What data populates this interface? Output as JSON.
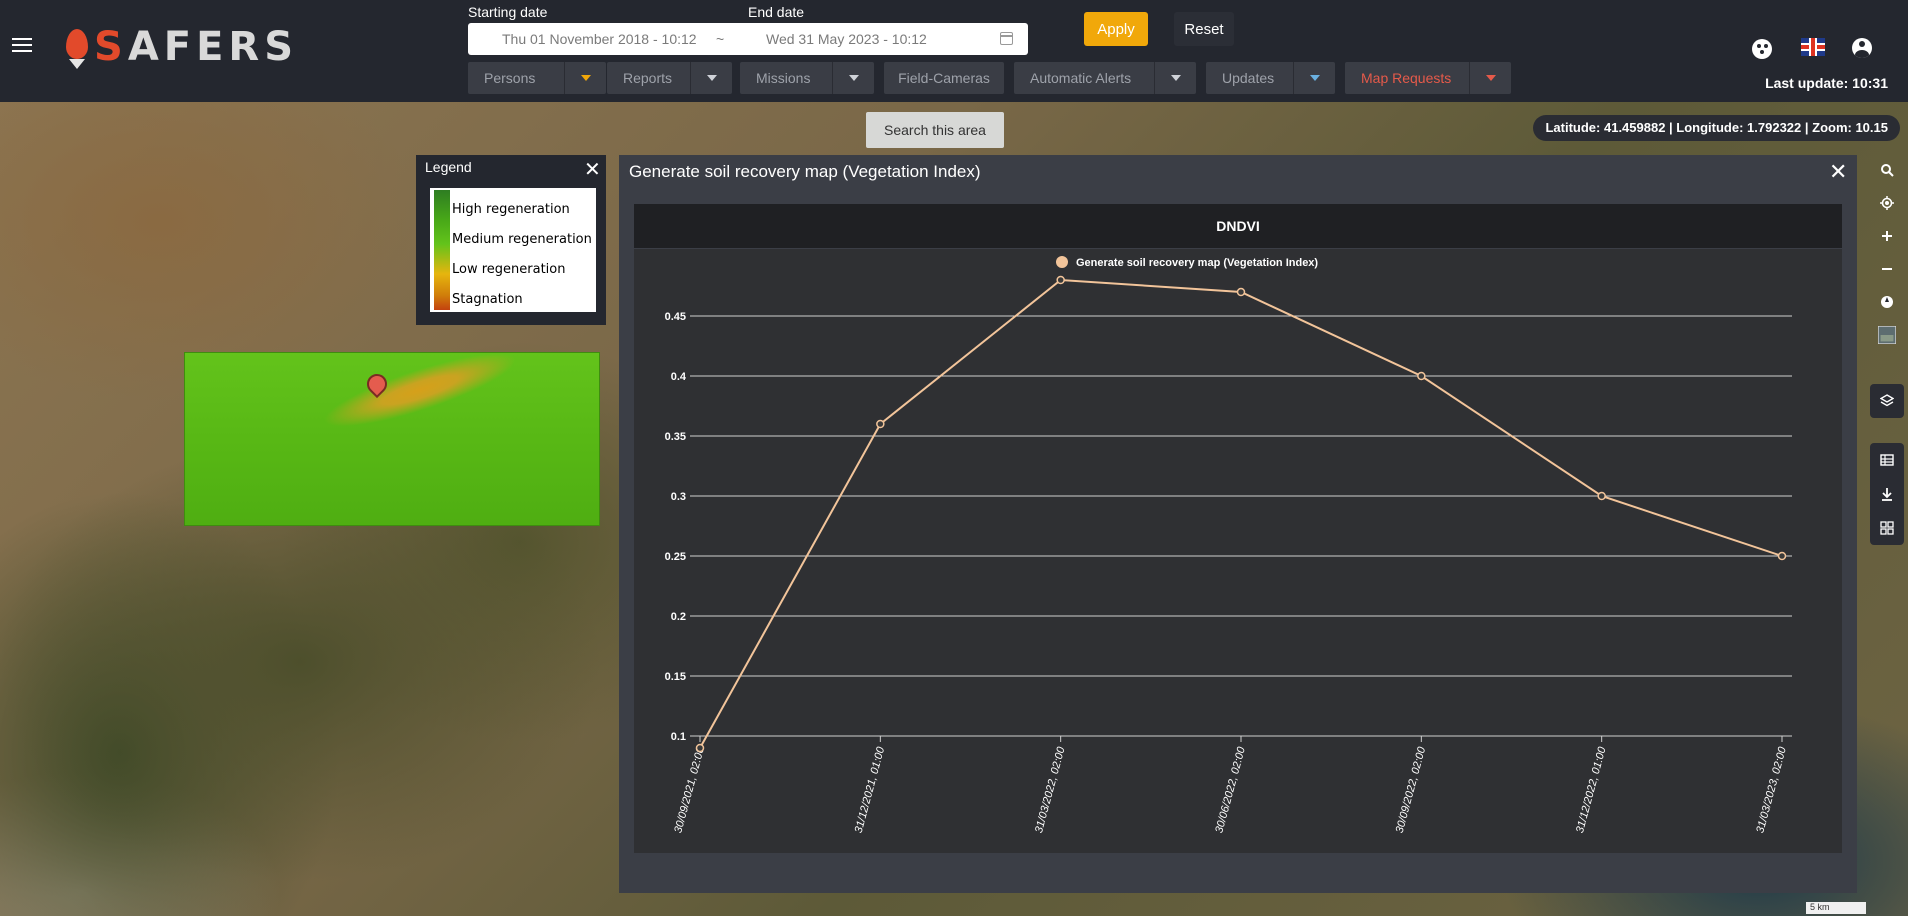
{
  "header": {
    "logo_text": "SAFERS",
    "starting_date_label": "Starting date",
    "end_date_label": "End date",
    "start_date_value": "Thu 01 November 2018 - 10:12",
    "date_separator": "~",
    "end_date_value": "Wed 31 May 2023 - 10:12",
    "apply_label": "Apply",
    "reset_label": "Reset",
    "last_update": "Last update: 10:31"
  },
  "layers": [
    {
      "label": "Persons",
      "caret_color": "#f1a80a"
    },
    {
      "label": "Reports",
      "caret_color": "#cfd2d8"
    },
    {
      "label": "Missions",
      "caret_color": "#cfd2d8"
    },
    {
      "label": "Field-Cameras",
      "caret_color": ""
    },
    {
      "label": "Automatic Alerts",
      "caret_color": "#cfd2d8"
    },
    {
      "label": "Updates",
      "caret_color": "#6ab0e0"
    },
    {
      "label": "Map Requests",
      "caret_color": "#e55a4a",
      "active_color": "#e55a4a"
    }
  ],
  "map": {
    "search_button": "Search this area",
    "coordinates": "Latitude: 41.459882 | Longitude: 1.792322 | Zoom: 10.15",
    "scale_label": "5 km"
  },
  "legend": {
    "title": "Legend",
    "items": [
      "High regeneration",
      "Medium regeneration",
      "Low regeneration",
      "Stagnation"
    ]
  },
  "panel": {
    "title": "Generate soil recovery map (Vegetation Index)"
  },
  "chart_data": {
    "type": "line",
    "title": "DNDVI",
    "series": [
      {
        "name": "Generate soil recovery map (Vegetation Index)",
        "color": "#f2c49a",
        "values": [
          0.09,
          0.36,
          0.48,
          0.47,
          0.4,
          0.3,
          0.25
        ]
      }
    ],
    "categories": [
      "30/09/2021, 02:00",
      "31/12/2021, 01:00",
      "31/03/2022, 02:00",
      "30/06/2022, 02:00",
      "30/09/2022, 02:00",
      "31/12/2022, 01:00",
      "31/03/2023, 02:00"
    ],
    "yticks": [
      "0.1",
      "0.15",
      "0.2",
      "0.25",
      "0.3",
      "0.35",
      "0.4",
      "0.45"
    ],
    "ylim": [
      0.1,
      0.45
    ],
    "grid": true,
    "legend_position": "top"
  }
}
